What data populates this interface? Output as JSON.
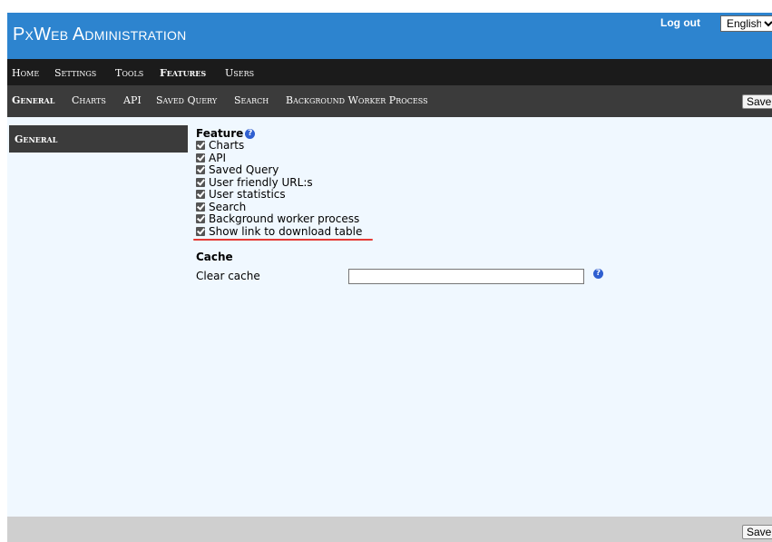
{
  "header": {
    "title": "PxWeb Administration",
    "logout_label": "Log out",
    "language": {
      "selected": "English"
    }
  },
  "nav_main": {
    "items": [
      {
        "label": "Home",
        "active": false
      },
      {
        "label": "Settings",
        "active": false
      },
      {
        "label": "Tools",
        "active": false
      },
      {
        "label": "Features",
        "active": true
      },
      {
        "label": "Users",
        "active": false
      }
    ]
  },
  "nav_sub": {
    "items": [
      {
        "label": "General",
        "active": true
      },
      {
        "label": "Charts",
        "active": false
      },
      {
        "label": "API",
        "active": false
      },
      {
        "label": "Saved Query",
        "active": false
      },
      {
        "label": "Search",
        "active": false
      },
      {
        "label": "Background Worker Process",
        "active": false
      }
    ],
    "save_label": "Save"
  },
  "sidebar": {
    "items": [
      {
        "label": "General",
        "active": true
      }
    ]
  },
  "feature": {
    "heading": "Feature",
    "help_icon": "help-icon",
    "items": [
      {
        "label": "Charts",
        "checked": true
      },
      {
        "label": "API",
        "checked": true
      },
      {
        "label": "Saved Query",
        "checked": true
      },
      {
        "label": "User friendly URL:s",
        "checked": true
      },
      {
        "label": "User statistics",
        "checked": true
      },
      {
        "label": "Search",
        "checked": true
      },
      {
        "label": "Background worker process",
        "checked": true
      },
      {
        "label": "Show link to download table",
        "checked": true
      }
    ]
  },
  "cache": {
    "heading": "Cache",
    "clear_label": "Clear cache",
    "clear_value": ""
  },
  "footer": {
    "save_label": "Save"
  },
  "colors": {
    "header_bg": "#2d84cf",
    "nav_main_bg": "#1b1b1b",
    "nav_sub_bg": "#3b3b3b",
    "page_bg": "#f0f8ff",
    "highlight_underline": "#e53935"
  }
}
